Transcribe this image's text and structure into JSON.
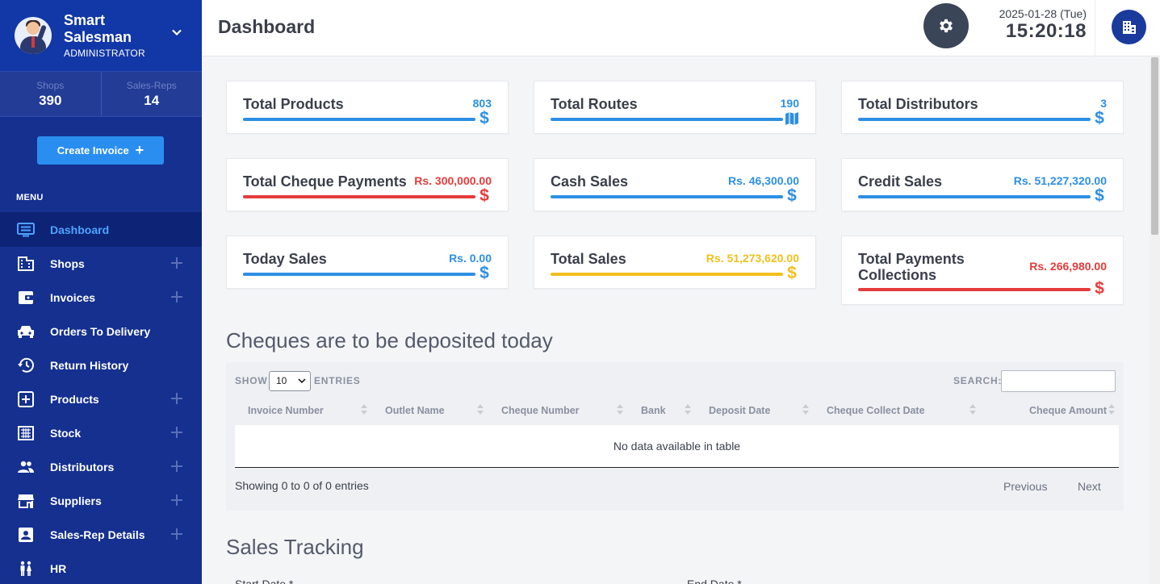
{
  "brand": {
    "name_line1": "Smart",
    "name_line2": "Salesman",
    "role": "ADMINISTRATOR"
  },
  "stats": [
    {
      "label": "Shops",
      "value": "390"
    },
    {
      "label": "Sales-Reps",
      "value": "14"
    }
  ],
  "create_invoice_label": "Create Invoice",
  "menu_title": "MENU",
  "menu": [
    {
      "label": "Dashboard",
      "icon": "monitor-icon",
      "active": true,
      "expandable": false
    },
    {
      "label": "Shops",
      "icon": "building-icon",
      "expandable": true
    },
    {
      "label": "Invoices",
      "icon": "wallet-icon",
      "expandable": true
    },
    {
      "label": "Orders To Delivery",
      "icon": "car-icon",
      "expandable": false
    },
    {
      "label": "Return History",
      "icon": "history-icon",
      "expandable": false
    },
    {
      "label": "Products",
      "icon": "add-box-icon",
      "expandable": true
    },
    {
      "label": "Stock",
      "icon": "grid-icon",
      "expandable": true
    },
    {
      "label": "Distributors",
      "icon": "people-icon",
      "expandable": true
    },
    {
      "label": "Suppliers",
      "icon": "store-icon",
      "expandable": true
    },
    {
      "label": "Sales-Rep Details",
      "icon": "contact-card-icon",
      "expandable": true
    },
    {
      "label": "HR",
      "icon": "wc-people-icon",
      "expandable": false
    }
  ],
  "header": {
    "title": "Dashboard",
    "date": "2025-01-28 (Tue)",
    "time": "15:20:18"
  },
  "cards": [
    {
      "title": "Total Products",
      "value": "803",
      "color": "#2d8fe4",
      "icon": "dollar-icon"
    },
    {
      "title": "Total Routes",
      "value": "190",
      "color": "#2d8fe4",
      "icon": "map-icon"
    },
    {
      "title": "Total Distributors",
      "value": "3",
      "color": "#2d8fe4",
      "icon": "dollar-icon"
    },
    {
      "title": "Total Cheque Payments",
      "value": "Rs. 300,000.00",
      "color": "#e53b3b",
      "icon": "dollar-icon"
    },
    {
      "title": "Cash Sales",
      "value": "Rs. 46,300.00",
      "color": "#2d8fe4",
      "icon": "dollar-icon"
    },
    {
      "title": "Credit Sales",
      "value": "Rs. 51,227,320.00",
      "color": "#2d8fe4",
      "icon": "dollar-icon"
    },
    {
      "title": "Today Sales",
      "value": "Rs. 0.00",
      "color": "#2d8fe4",
      "icon": "dollar-icon"
    },
    {
      "title": "Total Sales",
      "value": "Rs. 51,273,620.00",
      "color": "#f2c01c",
      "icon": "dollar-icon"
    },
    {
      "title_line1": "Total Payments",
      "title_line2": "Collections",
      "value": "Rs. 266,980.00",
      "color": "#e53b3b",
      "icon": "dollar-icon"
    }
  ],
  "cheques": {
    "title": "Cheques are to be deposited today",
    "show_label": "SHOW",
    "entries_label": "ENTRIES",
    "page_size": "10",
    "search_label": "SEARCH:",
    "search_value": "",
    "columns": [
      "Invoice Number",
      "Outlet Name",
      "Cheque Number",
      "Bank",
      "Deposit Date",
      "Cheque Collect Date",
      "Cheque Amount"
    ],
    "empty_text": "No data available in table",
    "info": "Showing 0 to 0 of 0 entries",
    "prev": "Previous",
    "next": "Next"
  },
  "tracking": {
    "title": "Sales Tracking",
    "start_label": "Start Date *",
    "end_label": "End Date *"
  }
}
